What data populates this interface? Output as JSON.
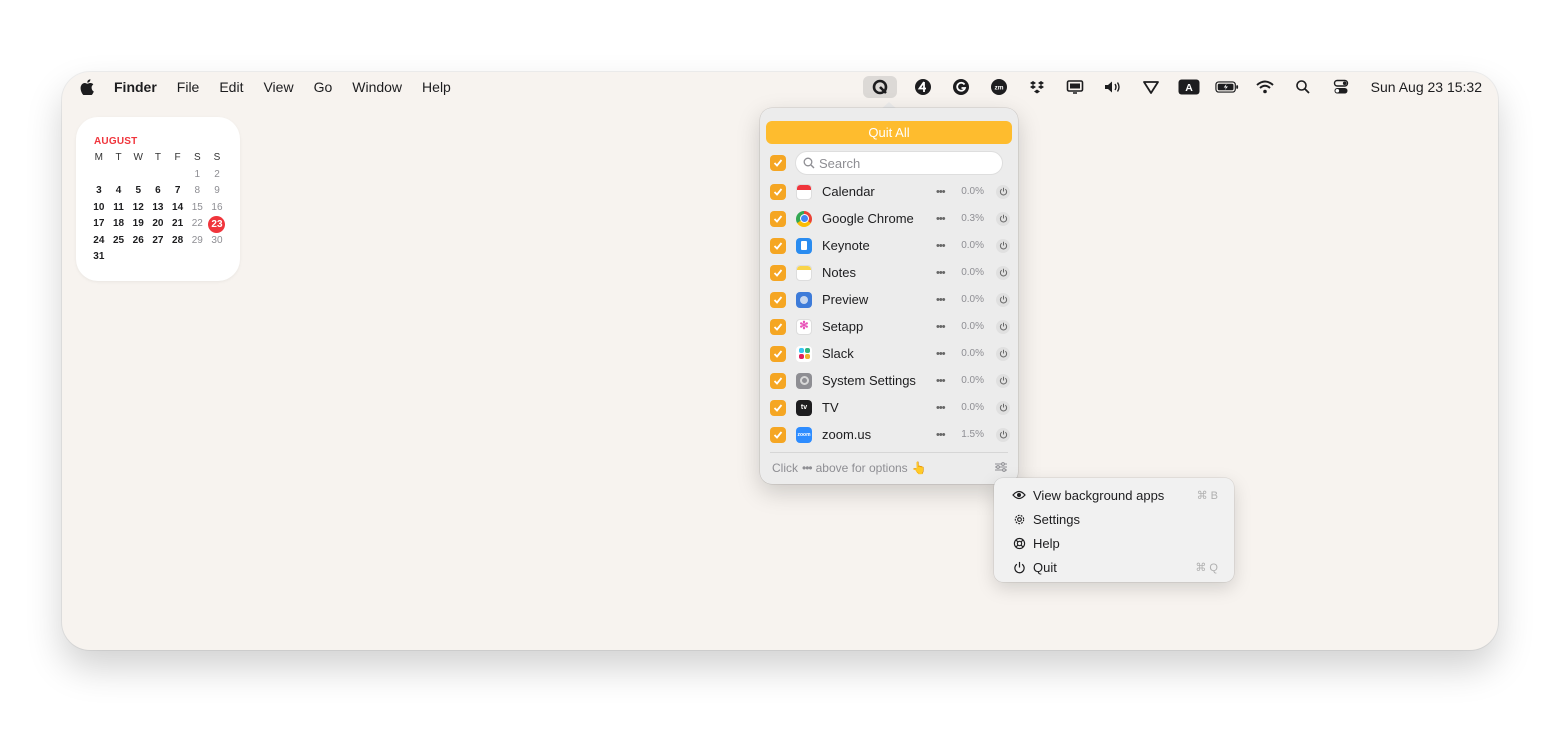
{
  "menubar": {
    "app_name": "Finder",
    "menus": [
      "File",
      "Edit",
      "View",
      "Go",
      "Window",
      "Help"
    ],
    "clock": "Sun Aug 23  15:32"
  },
  "calendar": {
    "month": "AUGUST",
    "weekdays": [
      "M",
      "T",
      "W",
      "T",
      "F",
      "S",
      "S"
    ],
    "weeks": [
      [
        "",
        "",
        "",
        "",
        "",
        "1",
        "2"
      ],
      [
        "3",
        "4",
        "5",
        "6",
        "7",
        "8",
        "9"
      ],
      [
        "10",
        "11",
        "12",
        "13",
        "14",
        "15",
        "16"
      ],
      [
        "17",
        "18",
        "19",
        "20",
        "21",
        "22",
        "23"
      ],
      [
        "24",
        "25",
        "26",
        "27",
        "28",
        "29",
        "30"
      ],
      [
        "31",
        "",
        "",
        "",
        "",
        "",
        ""
      ]
    ],
    "today": "23",
    "today_color": "#f0353c"
  },
  "popover": {
    "quit_all_label": "Quit All",
    "quit_all_color": "#febc2e",
    "search_placeholder": "Search",
    "apps": [
      {
        "name": "Calendar",
        "cpu": "0.0%",
        "icon": "calendar-app-icon"
      },
      {
        "name": "Google Chrome",
        "cpu": "0.3%",
        "icon": "chrome-app-icon"
      },
      {
        "name": "Keynote",
        "cpu": "0.0%",
        "icon": "keynote-app-icon"
      },
      {
        "name": "Notes",
        "cpu": "0.0%",
        "icon": "notes-app-icon"
      },
      {
        "name": "Preview",
        "cpu": "0.0%",
        "icon": "preview-app-icon"
      },
      {
        "name": "Setapp",
        "cpu": "0.0%",
        "icon": "setapp-app-icon"
      },
      {
        "name": "Slack",
        "cpu": "0.0%",
        "icon": "slack-app-icon"
      },
      {
        "name": "System Settings",
        "cpu": "0.0%",
        "icon": "system-settings-app-icon"
      },
      {
        "name": "TV",
        "cpu": "0.0%",
        "icon": "tv-app-icon"
      },
      {
        "name": "zoom.us",
        "cpu": "1.5%",
        "icon": "zoom-app-icon"
      }
    ],
    "footer_prefix": "Click",
    "footer_dots": "•••",
    "footer_suffix": "above for options",
    "footer_emoji": "👆",
    "check_color": "#f5a623"
  },
  "options_menu": {
    "items": [
      {
        "label": "View background apps",
        "shortcut": "⌘ B",
        "icon": "eye-icon"
      },
      {
        "label": "Settings",
        "shortcut": "",
        "icon": "gear-icon"
      },
      {
        "label": "Help",
        "shortcut": "",
        "icon": "lifebuoy-icon"
      },
      {
        "label": "Quit",
        "shortcut": "⌘ Q",
        "icon": "power-icon"
      }
    ]
  }
}
